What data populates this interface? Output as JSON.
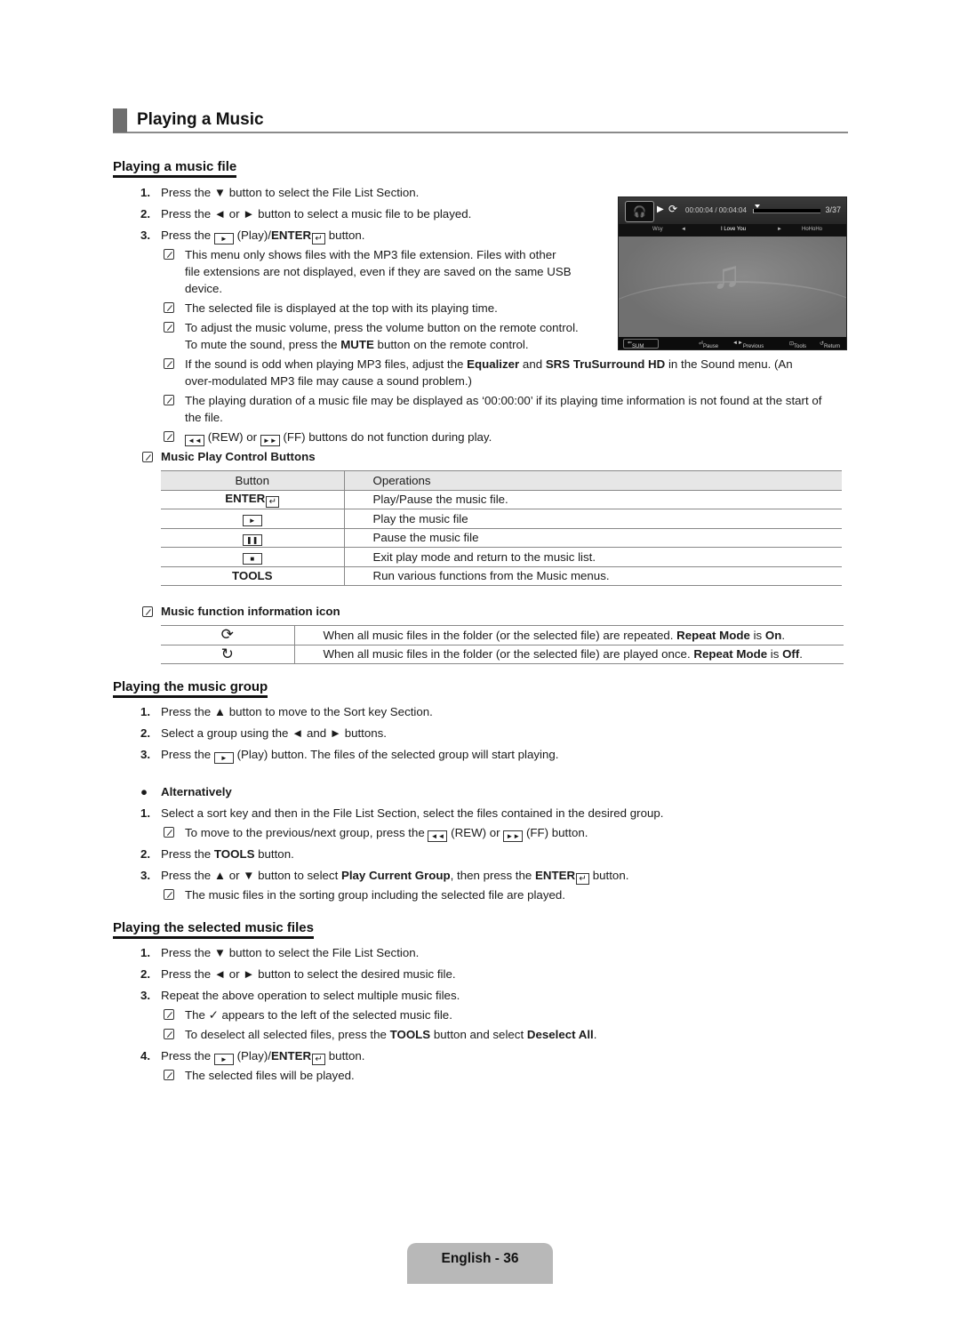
{
  "page_title": "Playing a Music",
  "sections": {
    "music_file": {
      "title": "Playing a music file",
      "steps": [
        {
          "num": "1.",
          "pre": "Press the ",
          "sym": "▼",
          "post": " button to select the File List Section."
        },
        {
          "num": "2.",
          "pre": "Press the ",
          "sym": "◄ or ►",
          "post": " button to select a music file to be played."
        },
        {
          "num": "3.",
          "pre": "Press the ",
          "key": "►",
          "mid": " (Play)/",
          "bold": "ENTER",
          "post": " button."
        }
      ],
      "notes": [
        "This menu only shows files with the MP3 file extension. Files with other",
        "file extensions are not displayed, even if they are saved on the same USB",
        "device.",
        "The selected file is displayed at the top with its playing time.",
        "To adjust the music volume, press the volume button on the remote control.",
        "To mute the sound, press the ",
        "MUTE",
        " button on the remote control."
      ],
      "note_eq": {
        "a": "If the sound is odd when playing MP3 files, adjust the ",
        "b1": "Equalizer",
        "c": " and ",
        "b2": "SRS TruSurround HD",
        "d": " in the Sound menu. (An",
        "line2": "over-modulated MP3 file may cause a sound problem.)"
      },
      "note_duration": {
        "line1": "The playing duration of a music file may be displayed as ‘00:00:00’ if its playing time information is not found at the start of",
        "line2": "the file."
      },
      "note_rew": {
        "rew": "◄◄",
        "a": " (REW) or ",
        "ff": "►►",
        "b": " (FF) buttons do not function during play."
      },
      "control_title": "Music Play Control Buttons",
      "control_table": {
        "headers": [
          "Button",
          "Operations"
        ],
        "rows": [
          {
            "button": "ENTER",
            "op": "Play/Pause the music file."
          },
          {
            "button": "►",
            "op": "Play the music file"
          },
          {
            "button": "❚❚",
            "op": "Pause the music file"
          },
          {
            "button": "■",
            "op": "Exit play mode and return to the music list."
          },
          {
            "button": "TOOLS",
            "op": "Run various functions from the Music menus."
          }
        ]
      },
      "icon_title": "Music function information icon",
      "icon_table": [
        {
          "icon": "repeat-on-icon",
          "glyph": "⟳",
          "text": "When all music files in the folder (or the selected file) are repeated. ",
          "b1": "Repeat Mode",
          "mid": " is ",
          "b2": "On",
          "end": "."
        },
        {
          "icon": "repeat-off-icon",
          "glyph": "↻",
          "text": "When all music files in the folder (or the selected file) are played once. ",
          "b1": "Repeat Mode",
          "mid": " is ",
          "b2": "Off",
          "end": "."
        }
      ]
    },
    "music_group": {
      "title": "Playing the music group",
      "steps": [
        {
          "num": "1.",
          "text": "Press the ▲ button to move to the Sort key Section."
        },
        {
          "num": "2.",
          "text": "Select a group using the ◄ and ► buttons."
        },
        {
          "num": "3.",
          "pre": "Press the ",
          "key": "►",
          "post": " (Play) button. The files of the selected group will start playing."
        }
      ],
      "alt_label": "Alternatively",
      "alt_steps": [
        {
          "num": "1.",
          "text": "Select a sort key and then in the File List Section, select the files contained in the desired group."
        },
        {
          "note": true,
          "pre": "To move to the previous/next group, press the ",
          "rew": "◄◄",
          "mid": " (REW) or ",
          "ff": "►►",
          "post": " (FF) button."
        },
        {
          "num": "2.",
          "pre": "Press the ",
          "bold": "TOOLS",
          "post": " button."
        },
        {
          "num": "3.",
          "pre": "Press the ▲ or ▼ button to select ",
          "bold": "Play Current Group",
          "mid": ", then press the ",
          "bold2": "ENTER",
          "post": " button."
        },
        {
          "note": true,
          "text": "The music files in the sorting group including the selected file are played."
        }
      ]
    },
    "selected_files": {
      "title": "Playing the selected music files",
      "steps": [
        {
          "num": "1.",
          "text": "Press the ▼ button to select the File List Section."
        },
        {
          "num": "2.",
          "text": "Press the ◄ or ► button to select the desired music file."
        },
        {
          "num": "3.",
          "text": "Repeat the above operation to select multiple music files."
        },
        {
          "note": true,
          "pre": "The ",
          "check": "✓",
          "post": " appears to the left of the selected music file."
        },
        {
          "note": true,
          "pre": "To deselect all selected files, press the ",
          "bold": "TOOLS",
          "mid": " button and select ",
          "bold2": "Deselect All",
          "post": "."
        },
        {
          "num": "4.",
          "pre": "Press the ",
          "key": "►",
          "mid": " (Play)/",
          "bold": "ENTER",
          "post": " button."
        },
        {
          "note": true,
          "text": "The selected files will be played."
        }
      ]
    }
  },
  "tv_screen": {
    "elapsed_total": "00:00:04 / 00:04:04",
    "progress_fraction": 0.016,
    "track_count": "3/37",
    "prev_track": "Wsy",
    "current_track": "I Love You",
    "next_track": "HoHoHo",
    "sum_label": "SUM",
    "hints": {
      "pause": "Pause",
      "prev_next": "Previous / Next",
      "tools": "Tools",
      "return": "Return"
    }
  },
  "footer": {
    "label": "English - 36"
  }
}
